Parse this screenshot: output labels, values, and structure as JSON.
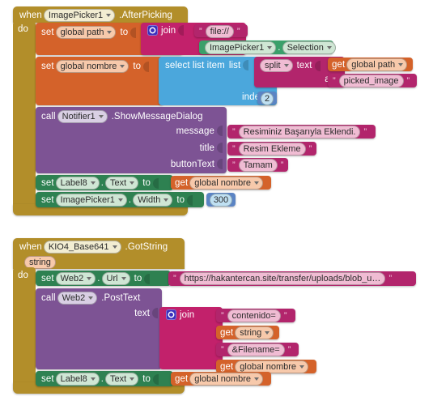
{
  "app": "MIT App Inventor Blocks Editor",
  "blocks": {
    "event1": {
      "when": "when",
      "component": "ImagePicker1",
      "event": ".AfterPicking",
      "do": "do",
      "statements": {
        "set_global_path": {
          "set": "set",
          "variable": "global path",
          "to": "to",
          "join": "join",
          "join_items": [
            {
              "type": "text",
              "value": "file://"
            },
            {
              "type": "component_get",
              "component": "ImagePicker1",
              "dot": ".",
              "property": "Selection"
            }
          ]
        },
        "set_global_nombre": {
          "set": "set",
          "variable": "global nombre",
          "to": "to",
          "select_list_item": "select list item",
          "list_label": "list",
          "index_label": "index",
          "index_value": "2",
          "split": "split",
          "text_label": "text",
          "at_label": "at",
          "split_text_get": "get",
          "split_text_var": "global path",
          "at_value": "picked_image"
        },
        "notifier_call": {
          "call": "call",
          "component": "Notifier1",
          "method": ".ShowMessageDialog",
          "args": [
            {
              "label": "message",
              "value": "Resiminiz Başarıyla Eklendi."
            },
            {
              "label": "title",
              "value": "Resim Ekleme"
            },
            {
              "label": "buttonText",
              "value": "Tamam"
            }
          ]
        },
        "set_label8_text": {
          "set": "set",
          "component": "Label8",
          "dot": ".",
          "property": "Text",
          "to": "to",
          "get": "get",
          "variable": "global nombre"
        },
        "set_imagepicker_width": {
          "set": "set",
          "component": "ImagePicker1",
          "dot": ".",
          "property": "Width",
          "to": "to",
          "number": "300"
        }
      }
    },
    "event2": {
      "when": "when",
      "component": "KIO4_Base641",
      "event": ".GotString",
      "param": "string",
      "do": "do",
      "statements": {
        "set_web2_url": {
          "set": "set",
          "component": "Web2",
          "dot": ".",
          "property": "Url",
          "to": "to",
          "value": "https://hakantercan.site/transfer/uploads/blob_u…"
        },
        "web2_posttext": {
          "call": "call",
          "component": "Web2",
          "method": ".PostText",
          "text_label": "text",
          "join": "join",
          "join_items": [
            {
              "type": "text",
              "value": "contenido="
            },
            {
              "type": "get",
              "get": "get",
              "variable": "string"
            },
            {
              "type": "text",
              "value": "&Filename="
            },
            {
              "type": "get",
              "get": "get",
              "variable": "global nombre"
            }
          ]
        },
        "set_label8_text": {
          "set": "set",
          "component": "Label8",
          "dot": ".",
          "property": "Text",
          "to": "to",
          "get": "get",
          "variable": "global nombre"
        }
      }
    }
  },
  "colors": {
    "event": "#b28e2a",
    "variable": "#d4622a",
    "component_set": "#2e8151",
    "component_get": "#3aa06a",
    "call": "#7d5394",
    "text": "#b2256c",
    "list": "#4ba7dc",
    "number": "#5b84c4",
    "mutator": "#3a2fbe",
    "background": "#ffffff"
  }
}
